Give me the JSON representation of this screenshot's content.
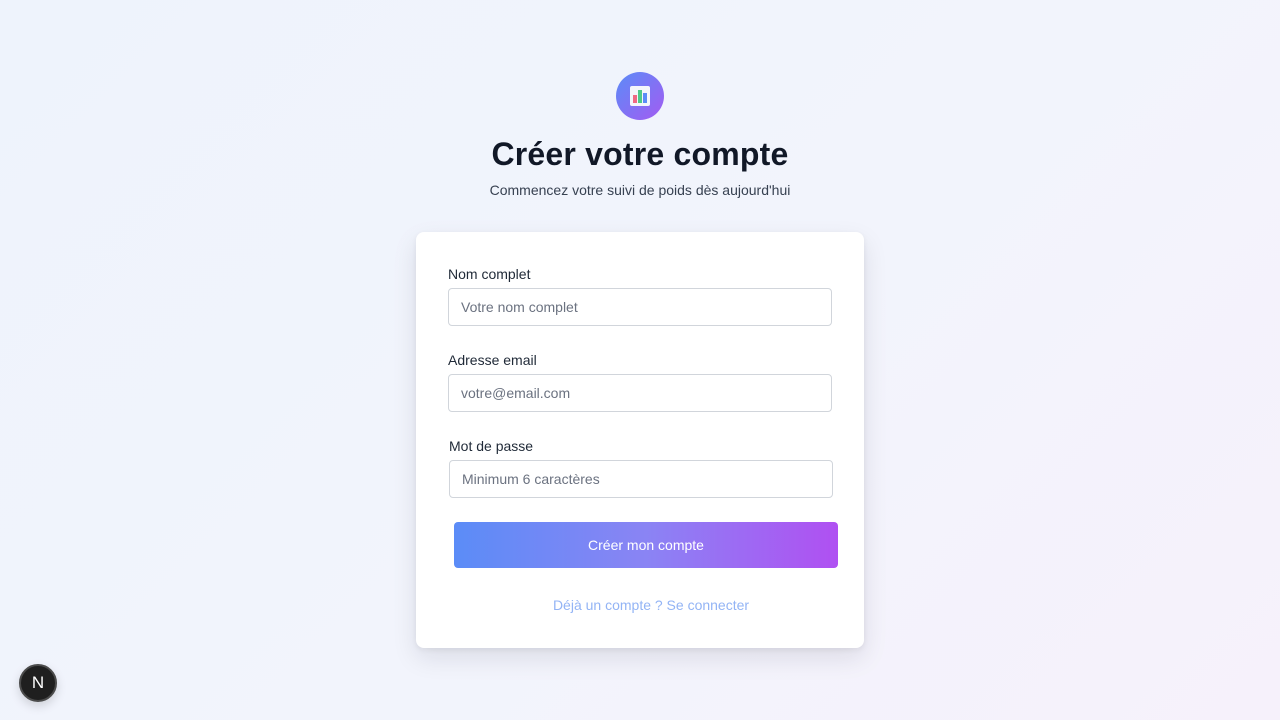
{
  "logo": {
    "icon": "bar-chart-icon",
    "gradient": [
      "#5b8cf7",
      "#a35bf2"
    ]
  },
  "header": {
    "title": "Créer votre compte",
    "subtitle": "Commencez votre suivi de poids dès aujourd'hui"
  },
  "form": {
    "name": {
      "label": "Nom complet",
      "placeholder": "Votre nom complet",
      "value": ""
    },
    "email": {
      "label": "Adresse email",
      "placeholder": "votre@email.com",
      "value": ""
    },
    "password": {
      "label": "Mot de passe",
      "placeholder": "Minimum 6 caractères",
      "value": ""
    },
    "submit_label": "Créer mon compte",
    "login_link": "Déjà un compte ? Se connecter"
  },
  "dev_badge": {
    "letter": "N"
  },
  "colors": {
    "accent_start": "#5b8cf7",
    "accent_end": "#b050f2",
    "link": "#93b4f5",
    "title": "#111827"
  }
}
